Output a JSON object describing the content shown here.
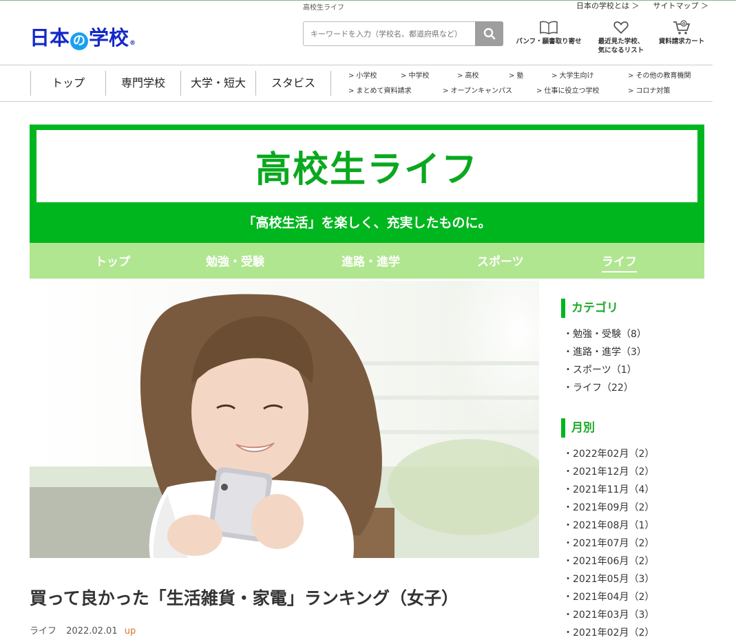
{
  "header": {
    "breadcrumb": "高校生ライフ",
    "about_link": "日本の学校とは ＞",
    "sitemap_link": "サイトマップ ＞",
    "logo_part1": "日本",
    "logo_no": "の",
    "logo_part2": "学校",
    "logo_reg": "®",
    "search_placeholder": "キーワードを入力（学校名、都道府県など）",
    "icon_pamphlet": "パンフ・願書取り寄せ",
    "icon_recent_line1": "最近見た学校、",
    "icon_recent_line2": "気になるリスト",
    "icon_cart": "資料請求カート"
  },
  "nav": {
    "main": [
      "トップ",
      "専門学校",
      "大学・短大",
      "スタビス"
    ],
    "sub": [
      "> 小学校",
      "> 中学校",
      "> 高校",
      "> 塾",
      "> 大学生向け",
      "> その他の教育機関",
      "> まとめて資料請求",
      "> オープンキャンパス",
      "> 仕事に役立つ学校",
      "> コロナ対策"
    ]
  },
  "hero": {
    "title": "高校生ライフ",
    "subtitle": "「高校生活」を楽しく、充実したものに。"
  },
  "category_nav": [
    "トップ",
    "勉強・受験",
    "進路・進学",
    "スポーツ",
    "ライフ"
  ],
  "article": {
    "title": "買って良かった「生活雑貨・家電」ランキング（女子）",
    "category": "ライフ",
    "date": "2022.02.01",
    "badge": "up"
  },
  "sidebar": {
    "category_heading": "カテゴリ",
    "categories": [
      "勉強・受験（8）",
      "進路・進学（3）",
      "スポーツ（1）",
      "ライフ（22）"
    ],
    "monthly_heading": "月別",
    "months": [
      "2022年02月（2）",
      "2021年12月（2）",
      "2021年11月（4）",
      "2021年09月（2）",
      "2021年08月（1）",
      "2021年07月（2）",
      "2021年06月（2）",
      "2021年05月（3）",
      "2021年04月（2）",
      "2021年03月（3）",
      "2021年02月（2）"
    ],
    "bullet": "・"
  },
  "colors": {
    "brand_green": "#00b61e",
    "light_green": "#b1e690",
    "logo_blue": "#1428c8",
    "up_orange": "#e0702c"
  }
}
